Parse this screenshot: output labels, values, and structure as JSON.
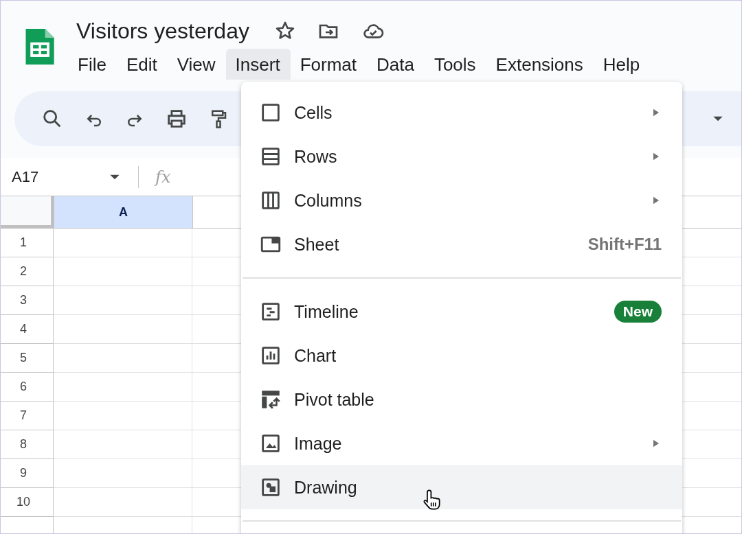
{
  "document": {
    "title": "Visitors yesterday"
  },
  "menubar": [
    {
      "label": "File",
      "selected": false
    },
    {
      "label": "Edit",
      "selected": false
    },
    {
      "label": "View",
      "selected": false
    },
    {
      "label": "Insert",
      "selected": true
    },
    {
      "label": "Format",
      "selected": false
    },
    {
      "label": "Data",
      "selected": false
    },
    {
      "label": "Tools",
      "selected": false
    },
    {
      "label": "Extensions",
      "selected": false
    },
    {
      "label": "Help",
      "selected": false
    }
  ],
  "name_box": {
    "value": "A17"
  },
  "formula_bar": {
    "label": "fx"
  },
  "grid": {
    "columns": [
      {
        "label": "A",
        "selected": true
      }
    ],
    "rows": [
      "1",
      "2",
      "3",
      "4",
      "5",
      "6",
      "7",
      "8",
      "9",
      "10"
    ]
  },
  "insert_menu": {
    "sections": [
      [
        {
          "label": "Cells",
          "submenu": true,
          "selected": false
        },
        {
          "label": "Rows",
          "submenu": true,
          "selected": false
        },
        {
          "label": "Columns",
          "submenu": true,
          "selected": false
        },
        {
          "label": "Sheet",
          "shortcut": "Shift+F11",
          "submenu": false,
          "selected": false
        }
      ],
      [
        {
          "label": "Timeline",
          "badge": "New",
          "submenu": false,
          "selected": false
        },
        {
          "label": "Chart",
          "submenu": false,
          "selected": false
        },
        {
          "label": "Pivot table",
          "submenu": false,
          "selected": false
        },
        {
          "label": "Image",
          "submenu": true,
          "selected": false
        },
        {
          "label": "Drawing",
          "submenu": false,
          "selected": true
        }
      ]
    ]
  }
}
